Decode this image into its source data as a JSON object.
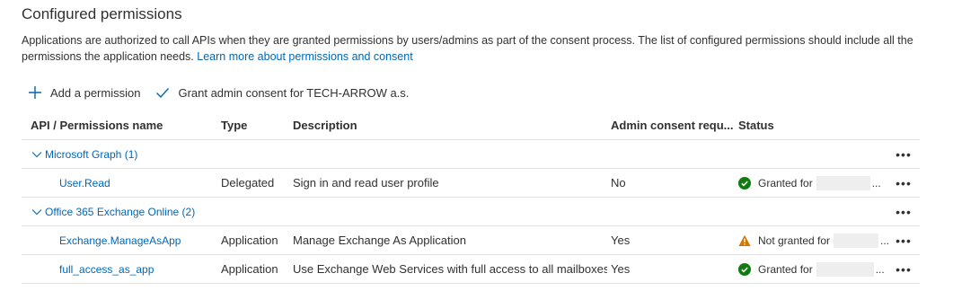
{
  "section": {
    "title": "Configured permissions",
    "description": "Applications are authorized to call APIs when they are granted permissions by users/admins as part of the consent process. The list of configured permissions should include all the permissions the application needs.",
    "learn_more_link": "Learn more about permissions and consent"
  },
  "toolbar": {
    "add_permission": "Add a permission",
    "grant_consent": "Grant admin consent for TECH-ARROW a.s."
  },
  "table": {
    "columns": {
      "api": "API / Permissions name",
      "type": "Type",
      "description": "Description",
      "admin_consent": "Admin consent requ...",
      "status": "Status"
    },
    "groups": [
      {
        "name": "Microsoft Graph (1)",
        "permissions": [
          {
            "name": "User.Read",
            "type": "Delegated",
            "description": "Sign in and read user profile",
            "admin_consent": "No",
            "status": "Granted for",
            "status_kind": "granted"
          }
        ]
      },
      {
        "name": "Office 365 Exchange Online (2)",
        "permissions": [
          {
            "name": "Exchange.ManageAsApp",
            "type": "Application",
            "description": "Manage Exchange As Application",
            "admin_consent": "Yes",
            "status": "Not granted for",
            "status_kind": "warning"
          },
          {
            "name": "full_access_as_app",
            "type": "Application",
            "description": "Use Exchange Web Services with full access to all mailboxes",
            "admin_consent": "Yes",
            "status": "Granted for",
            "status_kind": "granted"
          }
        ]
      }
    ],
    "more_label": "•••",
    "truncation": "..."
  },
  "colors": {
    "link": "#0067b8",
    "granted": "#107c10",
    "warning": "#d47500",
    "border": "#e1dfdd"
  },
  "icons": {
    "add": "plus-icon",
    "grant": "checkmark-icon",
    "group_toggle": "chevron-down-icon",
    "granted": "check-circle-icon",
    "warning": "warning-triangle-icon",
    "more": "more-horizontal-icon"
  }
}
